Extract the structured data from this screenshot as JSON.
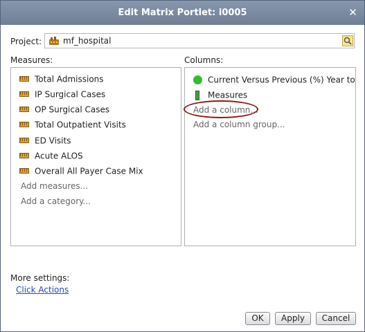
{
  "dialog": {
    "title": "Edit Matrix Portlet: i0005"
  },
  "project": {
    "label": "Project:",
    "value": "mf_hospital"
  },
  "measures": {
    "label": "Measures:",
    "items": [
      "Total Admissions",
      "IP Surgical Cases",
      "OP Surgical Cases",
      "Total Outpatient Visits",
      "ED Visits",
      "Acute ALOS",
      "Overall All Payer Case Mix"
    ],
    "add_measures": "Add measures...",
    "add_category": "Add a category..."
  },
  "columns": {
    "label": "Columns:",
    "items": [
      {
        "text": "Current Versus Previous (%) Year to",
        "icon": "green-circle-icon"
      },
      {
        "text": "Measures",
        "icon": "measures-bar-icon"
      }
    ],
    "add_column": "Add a column...",
    "add_column_group": "Add a column group...",
    "highlight_color": "#8b1a1a"
  },
  "more_settings": {
    "label": "More settings:",
    "link": "Click Actions"
  },
  "buttons": {
    "ok": "OK",
    "apply": "Apply",
    "cancel": "Cancel"
  },
  "colors": {
    "titlebar": "#7a8aa1",
    "link": "#2448b8",
    "status_green": "#2fbe2f"
  }
}
